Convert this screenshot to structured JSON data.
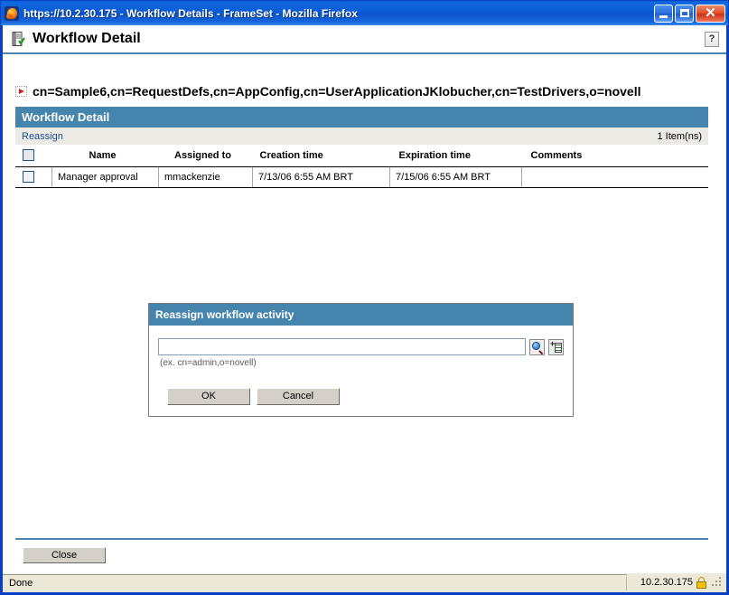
{
  "window": {
    "title": "https://10.2.30.175 - Workflow Details - FrameSet - Mozilla Firefox",
    "app_icon": "firefox-icon",
    "minimize_label": "",
    "maximize_label": "",
    "close_label": "✕"
  },
  "page": {
    "icon": "workflow-detail-icon",
    "title": "Workflow Detail",
    "help_label": "?"
  },
  "dn": {
    "icon": "expand-arrow-icon",
    "text": "cn=Sample6,cn=RequestDefs,cn=AppConfig,cn=UserApplicationJKlobucher,cn=TestDrivers,o=novell"
  },
  "panel": {
    "title": "Workflow Detail",
    "reassign_label": "Reassign",
    "item_count": "1 Item(ns)"
  },
  "table": {
    "columns": [
      {
        "key": "check",
        "label": ""
      },
      {
        "key": "name",
        "label": "Name"
      },
      {
        "key": "assigned_to",
        "label": "Assigned to"
      },
      {
        "key": "creation_time",
        "label": "Creation time"
      },
      {
        "key": "expiration_time",
        "label": "Expiration time"
      },
      {
        "key": "comments",
        "label": "Comments"
      }
    ],
    "rows": [
      {
        "name": "Manager approval",
        "assigned_to": "mmackenzie",
        "creation_time": "7/13/06 6:55 AM BRT",
        "expiration_time": "7/15/06 6:55 AM BRT",
        "comments": ""
      }
    ]
  },
  "dialog": {
    "title": "Reassign workflow activity",
    "input_value": "",
    "input_placeholder": "",
    "hint": "(ex. cn=admin,o=novell)",
    "lookup_icon": "object-selector-magnifier-icon",
    "history_icon": "object-history-icon",
    "ok_label": "OK",
    "cancel_label": "Cancel"
  },
  "footer": {
    "close_label": "Close"
  },
  "status": {
    "text": "Done",
    "host": "10.2.30.175",
    "lock_icon": "secure-lock-icon"
  },
  "colors": {
    "titlebar_blue": "#0a54cc",
    "window_border": "#0a3fc4",
    "panel_header": "#4584ad",
    "rule": "#4a86b0",
    "link": "#1f4e8c",
    "toolbar_bg": "#eceae5",
    "button_face": "#d4d0c8",
    "statusbar_bg": "#ece9d8",
    "lock_gold": "#f2c10a"
  }
}
